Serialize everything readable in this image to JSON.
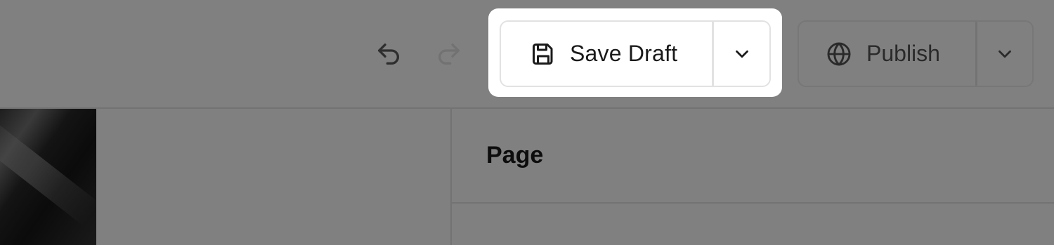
{
  "toolbar": {
    "undo_icon": "undo-icon",
    "redo_icon": "redo-icon",
    "save_draft": {
      "icon": "floppy-disk-icon",
      "label": "Save Draft",
      "menu_icon": "chevron-down-icon"
    },
    "publish": {
      "icon": "globe-icon",
      "label": "Publish",
      "menu_icon": "chevron-down-icon"
    }
  },
  "panel": {
    "title": "Page"
  },
  "colors": {
    "overlay": "#808080",
    "highlight": "#ffffff",
    "text": "#1a1a1a"
  }
}
